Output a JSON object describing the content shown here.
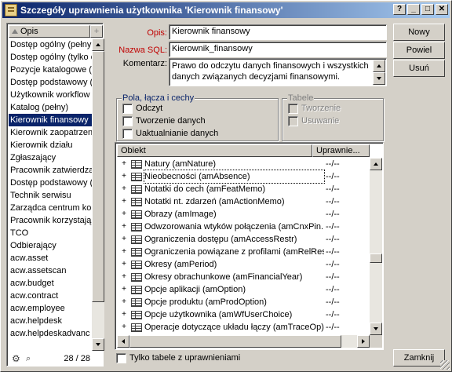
{
  "window": {
    "title": "Szczegóły uprawnienia użytkownika 'Kierownik finansowy'"
  },
  "list": {
    "header": "Opis",
    "items": [
      "Dostęp ogólny (pełny",
      "Dostęp ogólny (tylko c",
      "Pozycje katalogowe (",
      "Dostęp podstawowy (",
      "Użytkownik workflow",
      "Katalog (pełny)",
      "Kierownik finansowy",
      "Kierownik zaopatrzen",
      "Kierownik działu",
      "Zgłaszający",
      "Pracownik zatwierdza",
      "Dostęp podstawowy (",
      "Technik serwisu",
      "Zarządca centrum ko",
      "Pracownik korzystają",
      "TCO",
      "Odbierający",
      "acw.asset",
      "acw.assetscan",
      "acw.budget",
      "acw.contract",
      "acw.employee",
      "acw.helpdesk",
      "acw.helpdeskadvanc"
    ],
    "selected_index": 6,
    "count": "28 / 28"
  },
  "form": {
    "opis_label": "Opis:",
    "opis_value": "Kierownik finansowy",
    "sql_label": "Nazwa SQL:",
    "sql_value": "Kierownik_finansowy",
    "comment_label": "Komentarz:",
    "comment_value": "Prawo do odczytu danych finansowych i wszystkich danych związanych decyzjami finansowymi."
  },
  "buttons": {
    "new": "Nowy",
    "duplicate": "Powiel",
    "delete": "Usuń",
    "close": "Zamknij"
  },
  "fields_group": {
    "title": "Pola, łącza i cechy",
    "read": "Odczyt",
    "create": "Tworzenie danych",
    "update": "Uaktualnianie danych"
  },
  "tables_group": {
    "title": "Tabele",
    "create": "Tworzenie",
    "delete": "Usuwanie"
  },
  "tree": {
    "col_object": "Obiekt",
    "col_rights": "Uprawnie...",
    "rows": [
      {
        "name": "Natury (amNature)",
        "rights": "--/--"
      },
      {
        "name": "Nieobecności (amAbsence)",
        "rights": "--/--"
      },
      {
        "name": "Notatki do cech (amFeatMemo)",
        "rights": "--/--"
      },
      {
        "name": "Notatki nt. zdarzeń (amActionMemo)",
        "rights": "--/--"
      },
      {
        "name": "Obrazy (amImage)",
        "rights": "--/--"
      },
      {
        "name": "Odwzorowania wtyków połączenia (amCnxPin...",
        "rights": "--/--"
      },
      {
        "name": "Ograniczenia dostępu (amAccessRestr)",
        "rights": "--/--"
      },
      {
        "name": "Ograniczenia powiązane z profilami (amRelRes...",
        "rights": "--/--"
      },
      {
        "name": "Okresy (amPeriod)",
        "rights": "--/--"
      },
      {
        "name": "Okresy obrachunkowe (amFinancialYear)",
        "rights": "--/--"
      },
      {
        "name": "Opcje aplikacji (amOption)",
        "rights": "--/--"
      },
      {
        "name": "Opcje produktu (amProdOption)",
        "rights": "--/--"
      },
      {
        "name": "Opcje użytkownika (amWfUserChoice)",
        "rights": "--/--"
      },
      {
        "name": "Operacje dotyczące układu łączy (amTraceOp)",
        "rights": "--/--"
      }
    ]
  },
  "only_tables_label": "Tylko tabele z uprawnieniami",
  "colors": {
    "title_bar": "#0a246a",
    "required_label": "#c00000",
    "selection": "#0a246a"
  }
}
